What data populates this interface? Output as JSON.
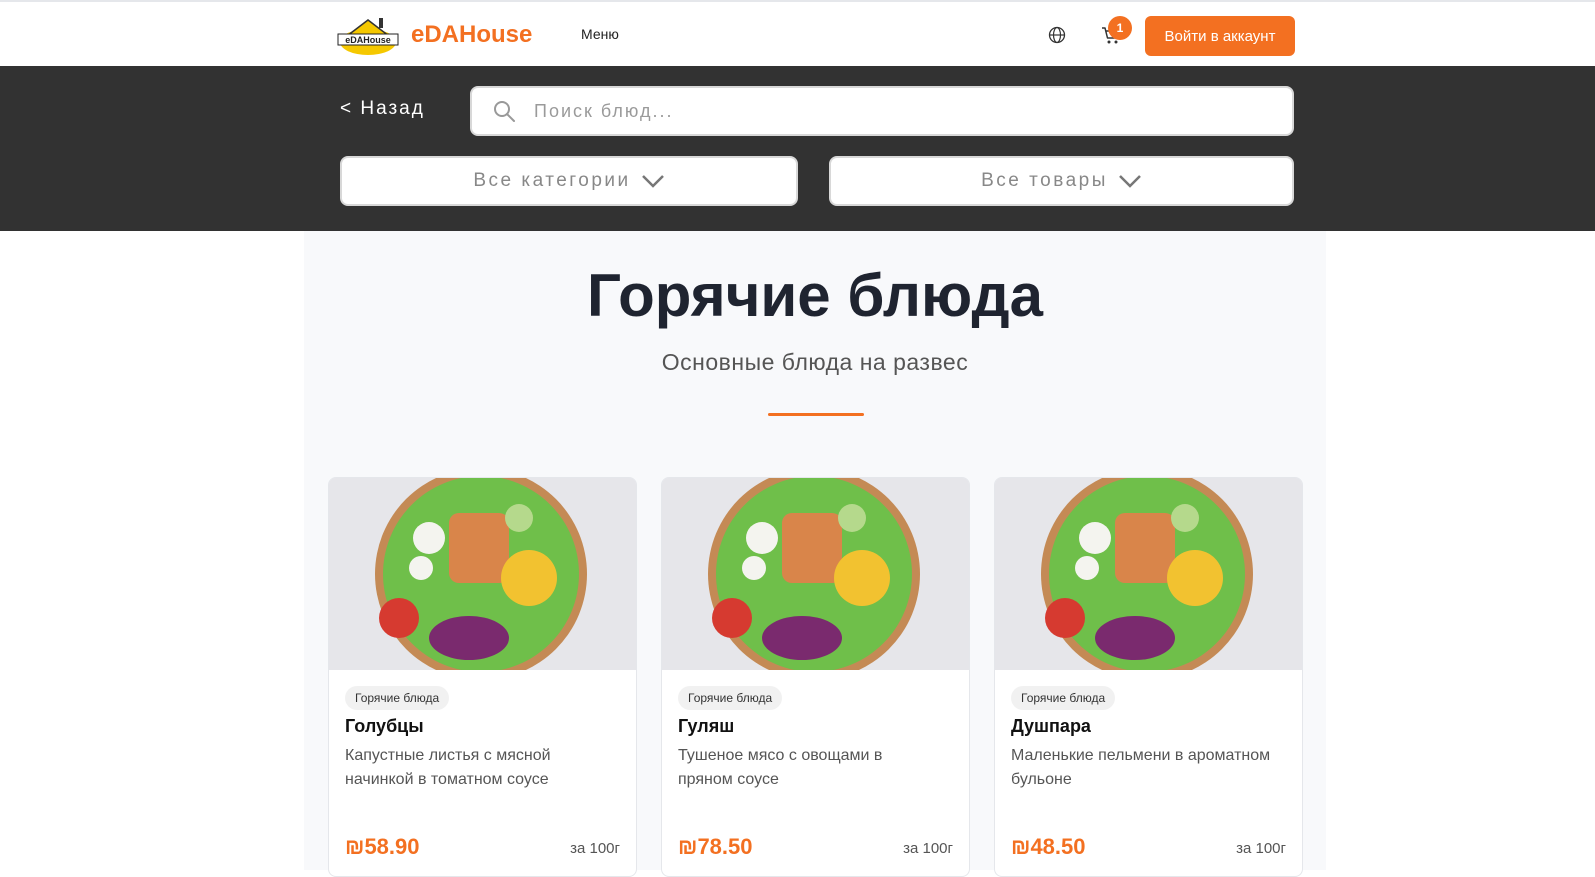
{
  "header": {
    "brand": "eDAHouse",
    "logo_text": "eDAHouse",
    "nav_menu": "Меню",
    "cart_count": "1",
    "login_label": "Войти в аккаунт"
  },
  "filters": {
    "back_label": "< Назад",
    "search_placeholder": "Поиск блюд...",
    "category_select": "Все категории",
    "product_select": "Все товары"
  },
  "section": {
    "title": "Горячие блюда",
    "subtitle": "Основные блюда на развес"
  },
  "products": [
    {
      "category": "Горячие блюда",
      "name": "Голубцы",
      "description": "Капустные листья с мясной начинкой в томатном соусе",
      "price": "₪58.90",
      "unit": "за 100г"
    },
    {
      "category": "Горячие блюда",
      "name": "Гуляш",
      "description": "Тушеное мясо с овощами в пряном соусе",
      "price": "₪78.50",
      "unit": "за 100г"
    },
    {
      "category": "Горячие блюда",
      "name": "Душпара",
      "description": "Маленькие пельмени в ароматном бульоне",
      "price": "₪48.50",
      "unit": "за 100г"
    }
  ],
  "colors": {
    "accent": "#f37021",
    "dark_bar": "#323232"
  }
}
